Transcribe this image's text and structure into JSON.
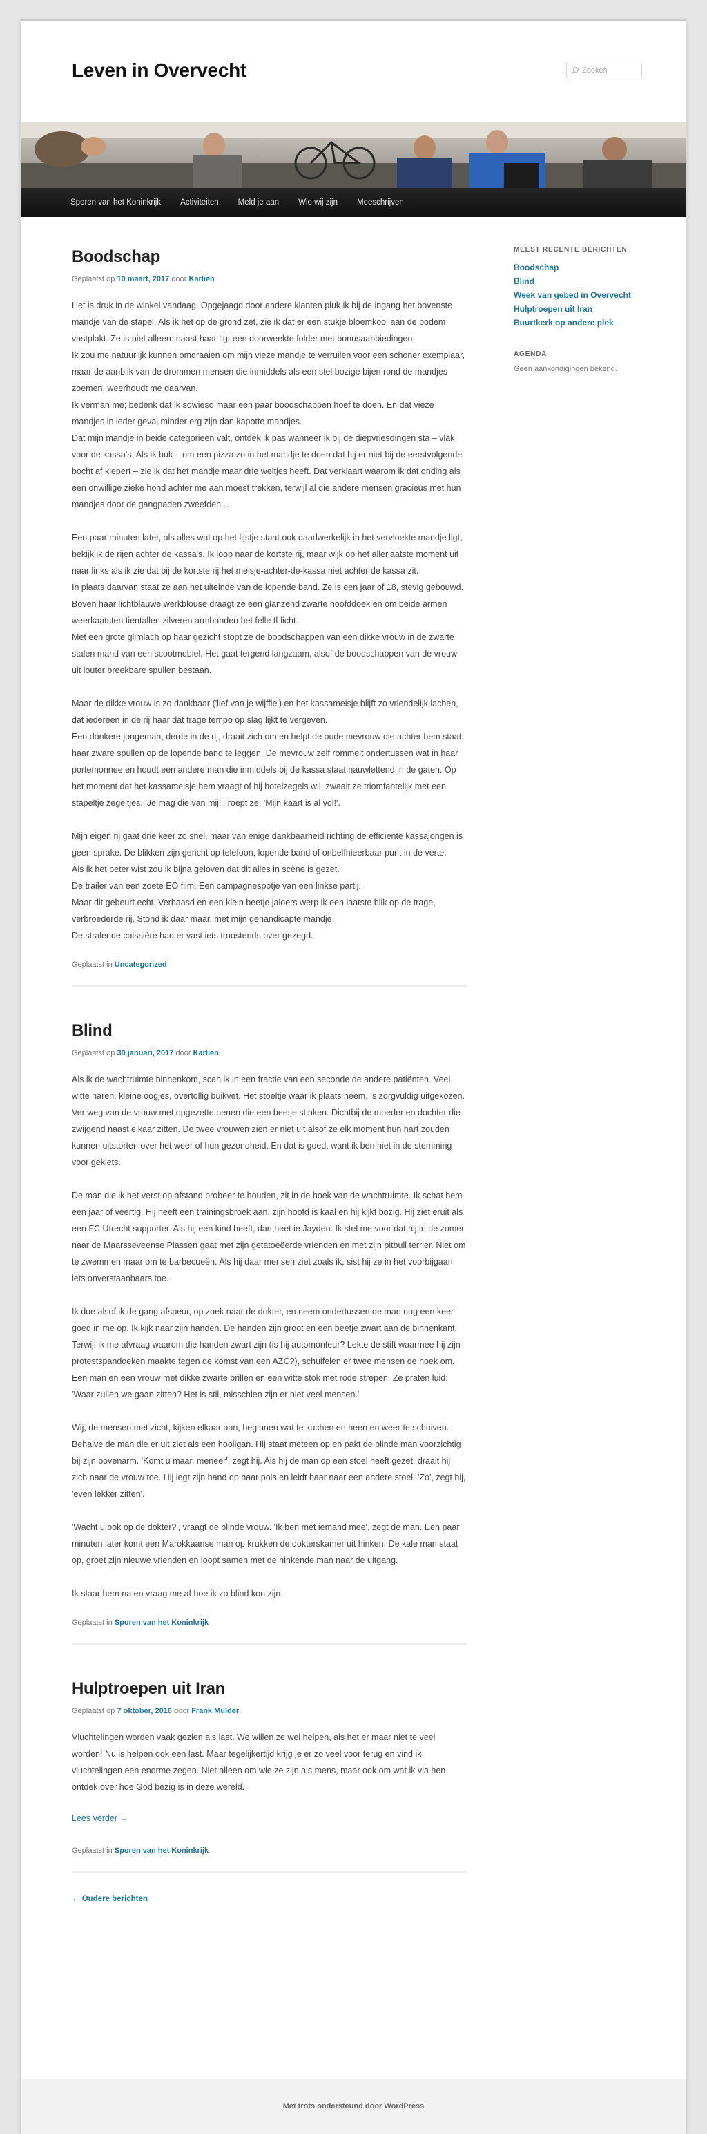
{
  "header": {
    "site_title": "Leven in Overvecht",
    "search_placeholder": "Zoeken"
  },
  "nav": [
    "Sporen van het Koninkrijk",
    "Activiteiten",
    "Meld je aan",
    "Wie wij zijn",
    "Meeschrijven"
  ],
  "posts": [
    {
      "title": "Boodschap",
      "meta_prefix": "Geplaatst op",
      "date": "10 maart, 2017",
      "by": "door",
      "author": "Karlien",
      "paragraphs": [
        [
          "Het is druk in de winkel vandaag. Opgejaagd door andere klanten pluk ik bij de ingang het bovenste mandje van de stapel. Als ik het op de grond zet, zie ik dat er een stukje bloemkool aan de bodem vastplakt. Ze is niet alleen: naast haar ligt een doorweekte folder met bonusaanbiedingen.",
          "Ik zou me natuurlijk kunnen omdraaien om mijn vieze mandje te verruilen voor een schoner exemplaar, maar de aanblik van de drommen mensen die inmiddels als een stel bozige bijen rond de mandjes zoemen, weerhoudt me daarvan.",
          "Ik verman me; bedenk dat ik sowieso maar een paar boodschappen hoef te doen. En dat vieze mandjes in ieder geval minder erg zijn dan kapotte mandjes.",
          "Dat mijn mandje in beide categorieën valt, ontdek ik pas wanneer ik bij de diepvriesdingen sta – vlak voor de kassa's. Als ik buk – om een pizza zo in het mandje te doen dat hij er niet bij de eerstvolgende bocht af kiepert – zie ik dat het mandje maar drie weltjes heeft. Dat verklaart waarom ik dat onding als een onwillige zieke hond achter me aan moest trekken, terwijl al die andere mensen gracieus met hun mandjes door de gangpaden zweefden…"
        ],
        [
          "Een paar minuten later, als alles wat op het lijstje staat ook daadwerkelijk in het vervloekte mandje ligt, bekijk ik de rijen achter de kassa's. Ik loop naar de kortste rij, maar wijk op het allerlaatste moment uit naar links als ik zie dat bij de kortste rij het meisje-achter-de-kassa niet achter de kassa zit.",
          "In plaats daarvan staat ze aan het uiteinde van de lopende band. Ze is een jaar of 18, stevig gebouwd. Boven haar lichtblauwe werkblouse draagt ze een glanzend zwarte hoofddoek en om beide armen weerkaatsten tientallen zilveren armbanden het felle tl-licht.",
          "Met een grote glimlach op haar gezicht stopt ze de boodschappen van een dikke vrouw in de zwarte stalen mand van een scootmobiel. Het gaat tergend langzaam, alsof de boodschappen van de vrouw uit louter breekbare spullen bestaan."
        ],
        [
          "Maar de dikke vrouw is zo dankbaar ('lief van je wijffie') en het kassameisje blijft zo vriendelijk lachen, dat iedereen in de rij haar dat trage tempo op slag lijkt te vergeven.",
          "Een donkere jongeman, derde in de rij, draait zich om en helpt de oude mevrouw die achter hem staat haar zware spullen op de lopende band te leggen. De mevrouw zelf rommelt ondertussen wat in haar portemonnee en houdt een andere man die inmiddels bij de kassa staat nauwlettend in de gaten. Op het moment dat het kassameisje hem vraagt of hij hotelzegels wil, zwaait ze triomfantelijk met een stapeltje zegeltjes. 'Je mag die van mij!', roept ze. 'Mijn kaart is al vol!'."
        ],
        [
          "Mijn eigen rij gaat drie keer zo snel, maar van enige dankbaarheid richting de efficiënte kassajongen is geen sprake. De blikken zijn gericht op telefoon, lopende band of onbelfnieerbaar punt in de verte.",
          "Als ik het beter wist zou ik bijna geloven dat dit alles in scène is gezet.",
          "De trailer van een zoete EO film. Een campagnespotje van een linkse partij.",
          "Maar dit gebeurt echt. Verbaasd en een klein beetje jaloers werp ik een laatste blik op de trage, verbroederde rij. Stond ik daar maar, met mijn gehandicapte mandje.",
          "De stralende caissière had er vast iets troostends over gezegd."
        ]
      ],
      "category_prefix": "Geplaatst in",
      "category": "Uncategorized"
    },
    {
      "title": "Blind",
      "meta_prefix": "Geplaatst op",
      "date": "30 januari, 2017",
      "by": "door",
      "author": "Karlien",
      "paragraphs": [
        [
          "Als ik de wachtruimte binnenkom, scan ik in een fractie van een seconde de andere patiënten. Veel witte haren, kleine oogjes, overtollig buikvet. Het stoeltje waar ik plaats neem, is zorgvuldig uitgekozen. Ver weg van de vrouw met opgezette benen die een beetje stinken. Dichtbij de moeder en dochter die zwijgend naast elkaar zitten. De twee vrouwen zien er niet uit alsof ze elk moment hun hart zouden kunnen uitstorten over het weer of hun gezondheid. En dat is goed, want ik ben niet in de stemming voor geklets."
        ],
        [
          "De man die ik het verst op afstand probeer te houden, zit in de hoek van de wachtruimte. Ik schat hem een jaar of veertig. Hij heeft een trainingsbroek aan, zijn hoofd is kaal en hij kijkt bozig. Hij ziet eruit als een FC Utrecht supporter. Als hij een kind heeft, dan heet ie Jayden. Ik stel me voor dat hij in de zomer naar de Maarsseveense Plassen gaat met zijn getatoeëerde vrienden en met zijn pitbull terrier. Niet om te zwemmen maar om te barbecueën. Als hij daar mensen ziet zoals ik, sist hij ze in het voorbijgaan iets onverstaanbaars toe."
        ],
        [
          "Ik doe alsof ik de gang afspeur, op zoek naar de dokter, en neem ondertussen de man nog een keer goed in me op. Ik kijk naar zijn handen. De handen zijn groot en een beetje zwart aan de binnenkant. Terwijl ik me afvraag waarom die handen zwart zijn (is hij automonteur? Lekte de stift waarmee hij zijn protestspandoeken maakte tegen de komst van een AZC?), schuifelen er twee mensen de hoek om. Een man en een vrouw met dikke zwarte brillen en een witte stok met rode strepen. Ze praten luid: 'Waar zullen we gaan zitten? Het is stil, misschien zijn er niet veel mensen.'"
        ],
        [
          "Wij, de mensen met zicht, kijken elkaar aan, beginnen wat te kuchen en heen en weer te schuiven. Behalve de man die er uit ziet als een hooligan. Hij staat meteen op en pakt de blinde man voorzichtig bij zijn bovenarm. 'Komt u maar, meneer', zegt hij. Als hij de man op een stoel heeft gezet, draait hij zich naar de vrouw toe. Hij legt zijn hand op haar pols en leidt haar naar een andere stoel. 'Zo', zegt hij, 'even lekker zitten'."
        ],
        [
          "'Wacht u ook op de dokter?', vraagt de blinde vrouw. 'Ik ben met iemand mee', zegt de man. Een paar minuten later komt een Marokkaanse man op krukken de dokterskamer uit hinken. De kale man staat op, groet zijn nieuwe vrienden en loopt samen met de hinkende man naar de uitgang."
        ],
        [
          "Ik staar hem na en vraag me af hoe ik zo blind kon zijn."
        ]
      ],
      "category_prefix": "Geplaatst in",
      "category": "Sporen van het Koninkrijk"
    },
    {
      "title": "Hulptroepen uit Iran",
      "meta_prefix": "Geplaatst op",
      "date": "7 oktober, 2016",
      "by": "door",
      "author": "Frank Mulder",
      "paragraphs": [
        [
          "Vluchtelingen worden vaak gezien als last. We willen ze wel helpen, als het er maar niet te veel worden! Nu is helpen ook een last. Maar tegelijkertijd krijg je er zo veel voor terug en vind ik vluchtelingen een enorme zegen. Niet alleen om wie ze zijn als mens, maar ook om wat ik via hen ontdek over hoe God bezig is in deze wereld."
        ]
      ],
      "more_link": "Lees verder →",
      "category_prefix": "Geplaatst in",
      "category": "Sporen van het Koninkrijk"
    }
  ],
  "older_posts": "← Oudere berichten",
  "sidebar": {
    "recent_title": "Meest recente berichten",
    "recent": [
      "Boodschap",
      "Blind",
      "Week van gebed in Overvecht",
      "Hulptroepen uit Iran",
      "Buurtkerk op andere plek"
    ],
    "agenda_title": "Agenda",
    "agenda_empty": "Geen aankondigingen bekend."
  },
  "footer": "Met trots ondersteund door WordPress",
  "colors": {
    "link": "#21759b",
    "nav_bg": "#1a1a1a",
    "page_bg": "#e6e6e6"
  }
}
